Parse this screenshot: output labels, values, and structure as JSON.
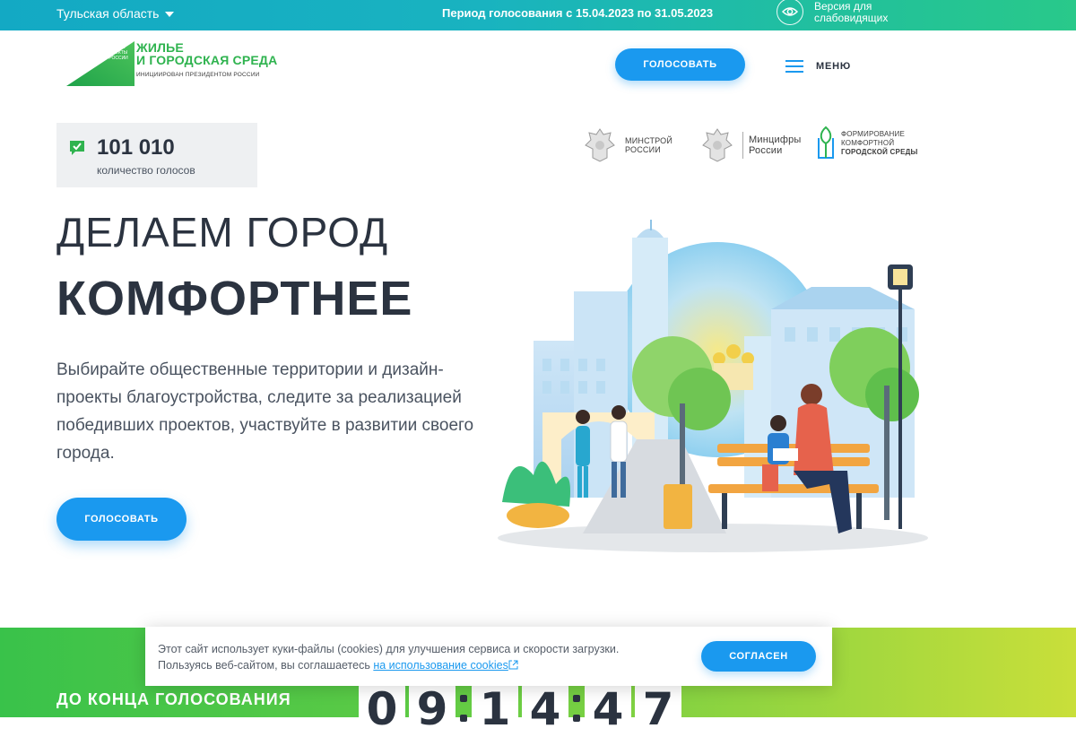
{
  "topbar": {
    "region": "Тульская область",
    "period": "Период голосования с 15.04.2023 по 31.05.2023",
    "a11y_line1": "Версия для",
    "a11y_line2": "слабовидящих"
  },
  "header": {
    "logo_title_line1": "ЖИЛЬЕ",
    "logo_title_line2": "И ГОРОДСКАЯ СРЕДА",
    "logo_subtitle": "ИНИЦИИРОВАН ПРЕЗИДЕНТОМ РОССИИ",
    "logo_badge_line1": "НАЦИОНАЛЬНЫЕ",
    "logo_badge_line2": "ПРОЕКТЫ",
    "logo_badge_line3": "РОССИИ",
    "vote_button": "ГОЛОСОВАТЬ",
    "menu_label": "МЕНЮ"
  },
  "counter": {
    "value": "101 010",
    "label": "количество голосов"
  },
  "partners": [
    {
      "line1": "МИНСТРОЙ",
      "line2": "РОССИИ"
    },
    {
      "line1": "Минцифры",
      "line2": "России"
    },
    {
      "line1": "ФОРМИРОВАНИЕ",
      "line2": "КОМФОРТНОЙ",
      "line3": "ГОРОДСКОЙ СРЕДЫ"
    }
  ],
  "hero": {
    "line1": "ДЕЛАЕМ ГОРОД",
    "line2": "КОМФОРТНЕЕ",
    "description": "Выбирайте общественные территории и дизайн-проекты благоустройства, следите за реализацией победивших проектов, участвуйте в развитии своего города.",
    "vote_button": "ГОЛОСОВАТЬ"
  },
  "countdown": {
    "label": "ДО КОНЦА ГОЛОСОВАНИЯ",
    "digits": [
      "0",
      "9",
      "1",
      "4",
      "4",
      "7"
    ]
  },
  "cookie": {
    "text_line1": "Этот сайт использует куки-файлы (cookies) для улучшения сервиса и скорости загрузки.",
    "text_line2_prefix": "Пользуясь веб-сайтом, вы соглашаетесь",
    "link": "на использование cookies",
    "agree_button": "СОГЛАСЕН"
  },
  "colors": {
    "accent_blue": "#1a99ef",
    "brand_green": "#2fb34f",
    "topbar_start": "#13a9c4",
    "topbar_end": "#29c98a"
  }
}
